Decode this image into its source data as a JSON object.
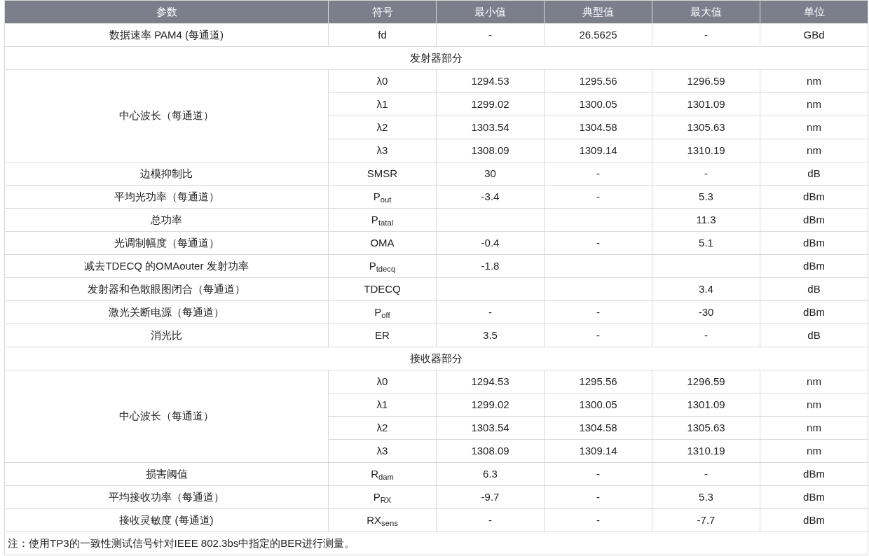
{
  "table": {
    "columns": [
      "参数",
      "符号",
      "最小值",
      "典型值",
      "最大值",
      "单位"
    ],
    "rows": [
      {
        "kind": "row",
        "cells": [
          "数据速率 PAM4 (每通道)",
          "fd",
          "-",
          "26.5625",
          "-",
          "GBd"
        ]
      },
      {
        "kind": "section",
        "title": "发射器部分"
      },
      {
        "kind": "group",
        "parameter": "中心波长（每通道）",
        "rows": [
          [
            "λ0",
            "1294.53",
            "1295.56",
            "1296.59",
            "nm"
          ],
          [
            "λ1",
            "1299.02",
            "1300.05",
            "1301.09",
            "nm"
          ],
          [
            "λ2",
            "1303.54",
            "1304.58",
            "1305.63",
            "nm"
          ],
          [
            "λ3",
            "1308.09",
            "1309.14",
            "1310.19",
            "nm"
          ]
        ]
      },
      {
        "kind": "row",
        "cells": [
          "边模抑制比",
          "SMSR",
          "30",
          "-",
          "-",
          "dB"
        ]
      },
      {
        "kind": "row",
        "cells": [
          "平均光功率（每通道）",
          "P$_{out}$",
          "-3.4",
          "-",
          "5.3",
          "dBm"
        ]
      },
      {
        "kind": "row",
        "cells": [
          "总功率",
          "P$_{tatal}$",
          "",
          "",
          "11.3",
          "dBm"
        ]
      },
      {
        "kind": "row",
        "cells": [
          "光调制幅度（每通道）",
          "OMA",
          "-0.4",
          "-",
          "5.1",
          "dBm"
        ]
      },
      {
        "kind": "row",
        "cells": [
          "减去TDECQ 的OMAouter 发射功率",
          "P$_{tdecq}$",
          "-1.8",
          "",
          "",
          "dBm"
        ]
      },
      {
        "kind": "row",
        "cells": [
          "发射器和色散眼图闭合（每通道）",
          "TDECQ",
          "",
          "",
          "3.4",
          "dB"
        ]
      },
      {
        "kind": "row",
        "cells": [
          "激光关断电源（每通道）",
          "P$_{off}$",
          "-",
          "-",
          "-30",
          "dBm"
        ]
      },
      {
        "kind": "row",
        "cells": [
          "消光比",
          "ER",
          "3.5",
          "-",
          "-",
          "dB"
        ]
      },
      {
        "kind": "section",
        "title": "接收器部分"
      },
      {
        "kind": "group",
        "parameter": "中心波长（每通道）",
        "rows": [
          [
            "λ0",
            "1294.53",
            "1295.56",
            "1296.59",
            "nm"
          ],
          [
            "λ1",
            "1299.02",
            "1300.05",
            "1301.09",
            "nm"
          ],
          [
            "λ2",
            "1303.54",
            "1304.58",
            "1305.63",
            "nm"
          ],
          [
            "λ3",
            "1308.09",
            "1309.14",
            "1310.19",
            "nm"
          ]
        ]
      },
      {
        "kind": "row",
        "cells": [
          "损害阈值",
          "R$_{dam}$",
          "6.3",
          "-",
          "-",
          "dBm"
        ]
      },
      {
        "kind": "row",
        "cells": [
          "平均接收功率（每通道）",
          "P$_{RX}$",
          "-9.7",
          "-",
          "5.3",
          "dBm"
        ]
      },
      {
        "kind": "row",
        "cells": [
          "接收灵敏度 (每通道)",
          "RX$_{sens}$",
          "-",
          "-",
          "-7.7",
          "dBm"
        ]
      },
      {
        "kind": "note",
        "text": "注：使用TP3的一致性测试信号针对IEEE 802.3bs中指定的BER进行测量。"
      }
    ]
  }
}
